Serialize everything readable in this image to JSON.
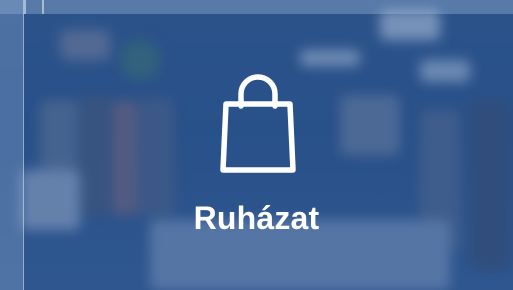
{
  "tile": {
    "label": "Ruházat",
    "icon": "shopping-bag-icon",
    "overlay_color": "#2a5a9a",
    "text_color": "#ffffff"
  }
}
